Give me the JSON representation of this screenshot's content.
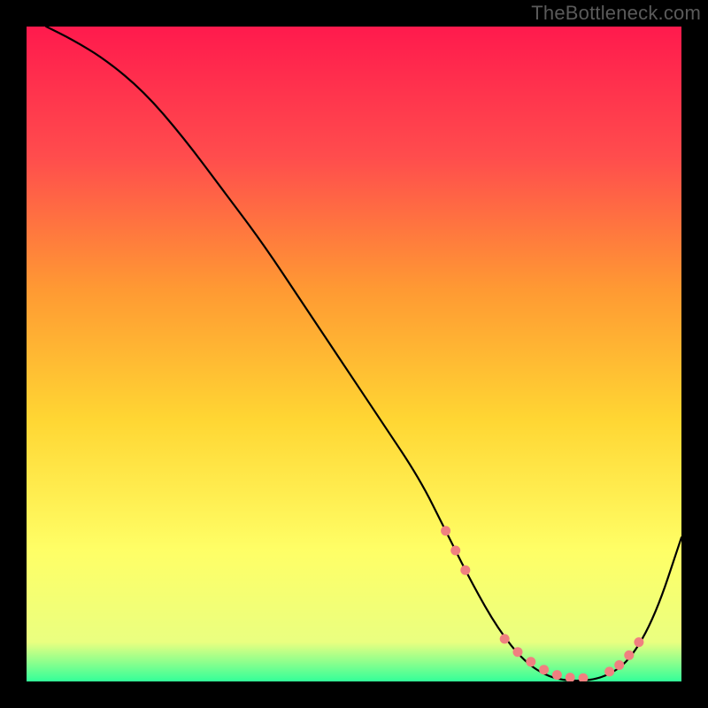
{
  "watermark": "TheBottleneck.com",
  "chart_data": {
    "type": "line",
    "title": "",
    "xlabel": "",
    "ylabel": "",
    "xlim": [
      0,
      100
    ],
    "ylim": [
      0,
      100
    ],
    "grid": false,
    "legend": false,
    "background_gradient": {
      "stops": [
        {
          "offset": 0.0,
          "color": "#ff1a4d"
        },
        {
          "offset": 0.2,
          "color": "#ff4d4d"
        },
        {
          "offset": 0.4,
          "color": "#ff9933"
        },
        {
          "offset": 0.6,
          "color": "#ffd633"
        },
        {
          "offset": 0.8,
          "color": "#ffff66"
        },
        {
          "offset": 0.94,
          "color": "#eaff80"
        },
        {
          "offset": 1.0,
          "color": "#33ff99"
        }
      ]
    },
    "series": [
      {
        "name": "bottleneck-curve",
        "stroke": "#000000",
        "x": [
          3,
          7,
          12,
          18,
          24,
          30,
          36,
          42,
          48,
          54,
          60,
          64,
          68,
          72,
          76,
          80,
          84,
          88,
          92,
          96,
          100
        ],
        "values": [
          100,
          98,
          95,
          90,
          83,
          75,
          67,
          58,
          49,
          40,
          31,
          23,
          15,
          8,
          3,
          0.5,
          0,
          0.5,
          3,
          10,
          22
        ]
      }
    ],
    "markers": {
      "name": "highlight-dots",
      "color": "#f08080",
      "x": [
        64,
        65.5,
        67,
        73,
        75,
        77,
        79,
        81,
        83,
        85,
        89,
        90.5,
        92,
        93.5
      ],
      "values": [
        23,
        20,
        17,
        6.5,
        4.5,
        3,
        1.8,
        1,
        0.6,
        0.5,
        1.5,
        2.5,
        4,
        6
      ]
    }
  }
}
